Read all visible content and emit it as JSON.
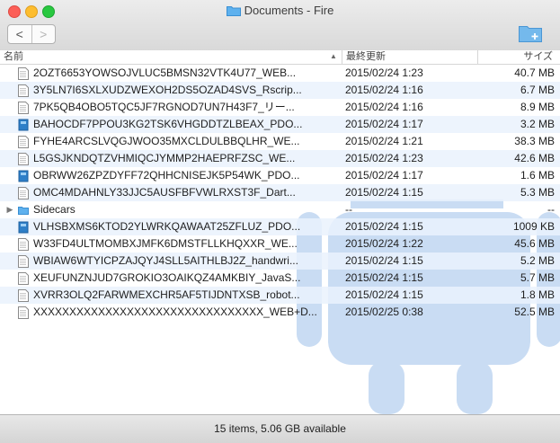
{
  "window": {
    "title": "Documents - Fire"
  },
  "toolbar": {
    "back_label": "<",
    "forward_label": ">"
  },
  "columns": {
    "name": "名前",
    "sort_indicator": "▲",
    "date": "最終更新",
    "size": "サイズ"
  },
  "rows": [
    {
      "name": "2OZT6653YOWSOJVLUC5BMSN32VTK4U77_WEB...",
      "date": "2015/02/24 1:23",
      "size": "40.7 MB",
      "icon": "document-icon",
      "kind": "file"
    },
    {
      "name": "3Y5LN7I6SXLXUDZWEXOH2DS5OZAD4SVS_Rscrip...",
      "date": "2015/02/24 1:16",
      "size": "6.7 MB",
      "icon": "document-icon",
      "kind": "file"
    },
    {
      "name": "7PK5QB4OBO5TQC5JF7RGNOD7UN7H43F7_リー...",
      "date": "2015/02/24 1:16",
      "size": "8.9 MB",
      "icon": "document-icon",
      "kind": "file"
    },
    {
      "name": "BAHOCDF7PPOU3KG2TSK6VHGDDTZLBEAX_PDO...",
      "date": "2015/02/24 1:17",
      "size": "3.2 MB",
      "icon": "ebook-icon",
      "kind": "file"
    },
    {
      "name": "FYHE4ARCSLVQGJWOO35MXCLDULBBQLHR_WE...",
      "date": "2015/02/24 1:21",
      "size": "38.3 MB",
      "icon": "document-icon",
      "kind": "file"
    },
    {
      "name": "L5GSJKNDQTZVHMIQCJYMMP2HAEPRFZSC_WE...",
      "date": "2015/02/24 1:23",
      "size": "42.6 MB",
      "icon": "document-icon",
      "kind": "file"
    },
    {
      "name": "OBRWW26ZPZDYFF72QHHCNISEJK5P54WK_PDO...",
      "date": "2015/02/24 1:17",
      "size": "1.6 MB",
      "icon": "ebook-icon",
      "kind": "file"
    },
    {
      "name": "OMC4MDAHNLY33JJC5AUSFBFVWLRXST3F_Dart...",
      "date": "2015/02/24 1:15",
      "size": "5.3 MB",
      "icon": "document-icon",
      "kind": "file"
    },
    {
      "name": "Sidecars",
      "date": "--",
      "size": "--",
      "icon": "folder-icon",
      "kind": "folder",
      "disclosure": "▶"
    },
    {
      "name": "VLHSBXMS6KTOD2YLWRKQAWAAT25ZFLUZ_PDO...",
      "date": "2015/02/24 1:15",
      "size": "1009 KB",
      "icon": "ebook-icon",
      "kind": "file"
    },
    {
      "name": "W33FD4ULTMOMBXJMFK6DMSTFLLKHQXXR_WE...",
      "date": "2015/02/24 1:22",
      "size": "45.6 MB",
      "icon": "document-icon",
      "kind": "file"
    },
    {
      "name": "WBIAW6WTYICPZAJQYJ4SLL5AITHLBJ2Z_handwri...",
      "date": "2015/02/24 1:15",
      "size": "5.2 MB",
      "icon": "document-icon",
      "kind": "file"
    },
    {
      "name": "XEUFUNZNJUD7GROKIO3OAIKQZ4AMKBIY_JavaS...",
      "date": "2015/02/24 1:15",
      "size": "5.7 MB",
      "icon": "document-icon",
      "kind": "file"
    },
    {
      "name": "XVRR3OLQ2FARWMEXCHR5AF5TIJDNTXSB_robot...",
      "date": "2015/02/24 1:15",
      "size": "1.8 MB",
      "icon": "document-icon",
      "kind": "file"
    },
    {
      "name": "XXXXXXXXXXXXXXXXXXXXXXXXXXXXXXXX_WEB+D...",
      "date": "2015/02/25 0:38",
      "size": "52.5 MB",
      "icon": "document-icon",
      "kind": "file"
    }
  ],
  "status": {
    "text": "15 items, 5.06 GB available"
  },
  "colors": {
    "selection_tint": "#eaf2fd",
    "folder": "#4fa7e8",
    "watermark": "#c9dcf3"
  }
}
